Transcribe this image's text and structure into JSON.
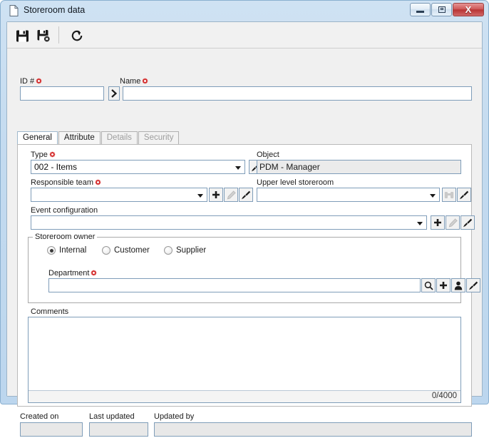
{
  "window": {
    "title": "Storeroom data",
    "icon": "document-icon",
    "controls": {
      "minimize": "minimize-icon",
      "maximize": "maximize-icon",
      "close": "X"
    }
  },
  "toolbar": {
    "buttons": [
      {
        "name": "save-button",
        "icon": "floppy-disk-icon",
        "tooltip": "Save"
      },
      {
        "name": "save-and-close-button",
        "icon": "floppy-disk-close-icon",
        "tooltip": "Save and close"
      },
      {
        "name": "refresh-button",
        "icon": "refresh-icon",
        "tooltip": "Refresh"
      }
    ]
  },
  "header": {
    "id_label": "ID #",
    "id_value": "",
    "expand_button": "❯",
    "name_label": "Name",
    "name_value": ""
  },
  "tabs": [
    {
      "label": "General",
      "active": true,
      "disabled": false
    },
    {
      "label": "Attribute",
      "active": false,
      "disabled": false
    },
    {
      "label": "Details",
      "active": false,
      "disabled": true
    },
    {
      "label": "Security",
      "active": false,
      "disabled": true
    }
  ],
  "general": {
    "type_label": "Type",
    "type_value": "002 - Items",
    "object_label": "Object",
    "object_value": "PDM - Manager",
    "responsible_team_label": "Responsible team",
    "responsible_team_value": "",
    "upper_level_storeroom_label": "Upper level storeroom",
    "upper_level_storeroom_value": "",
    "event_configuration_label": "Event configuration",
    "event_configuration_value": "",
    "storeroom_owner_legend": "Storeroom owner",
    "owner_options": [
      {
        "label": "Internal",
        "selected": true
      },
      {
        "label": "Customer",
        "selected": false
      },
      {
        "label": "Supplier",
        "selected": false
      }
    ],
    "department_label": "Department",
    "department_value": "",
    "comments_label": "Comments",
    "comments_value": "",
    "comments_counter": "0/4000"
  },
  "footer": {
    "created_on_label": "Created on",
    "created_on_value": "",
    "last_updated_label": "Last updated",
    "last_updated_value": "",
    "updated_by_label": "Updated by",
    "updated_by_value": ""
  },
  "colors": {
    "title_bar": "#c3daef",
    "close_button": "#b83434",
    "required_marker": "#d42a2a",
    "active_tab_underline": "#2e9e4a",
    "field_border": "#7f9db9"
  }
}
